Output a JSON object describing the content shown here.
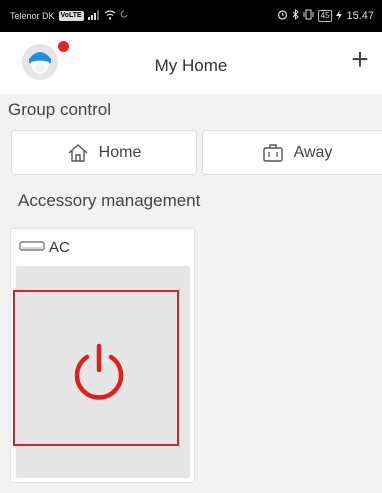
{
  "status_bar": {
    "carrier": "Telenor DK",
    "volte": "VoLTE",
    "battery": "45",
    "time": "15.47"
  },
  "header": {
    "title": "My Home",
    "add_label": "+"
  },
  "group_control": {
    "title": "Group control",
    "buttons": [
      {
        "label": "Home",
        "icon": "home-icon"
      },
      {
        "label": "Away",
        "icon": "suitcase-icon"
      }
    ]
  },
  "accessory_management": {
    "title": "Accessory management",
    "devices": [
      {
        "name": "AC",
        "icon": "ac-unit-icon",
        "power_icon": "power-icon"
      }
    ]
  },
  "colors": {
    "accent_red": "#e02020",
    "avatar_blue": "#1f8fe0",
    "notification_dot": "#e8232c"
  }
}
